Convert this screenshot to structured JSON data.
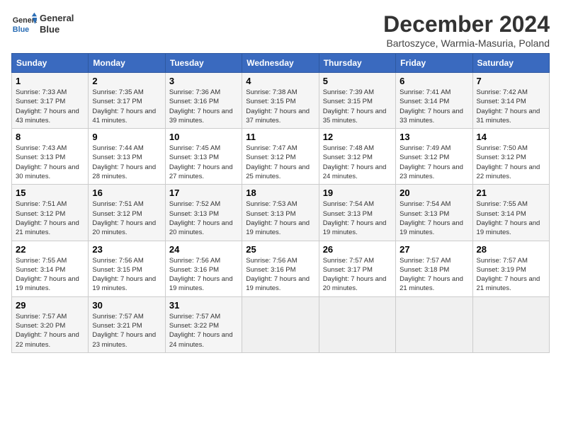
{
  "header": {
    "logo_line1": "General",
    "logo_line2": "Blue",
    "month_title": "December 2024",
    "subtitle": "Bartoszyce, Warmia-Masuria, Poland"
  },
  "days_of_week": [
    "Sunday",
    "Monday",
    "Tuesday",
    "Wednesday",
    "Thursday",
    "Friday",
    "Saturday"
  ],
  "weeks": [
    [
      {
        "day": "1",
        "sunrise": "Sunrise: 7:33 AM",
        "sunset": "Sunset: 3:17 PM",
        "daylight": "Daylight: 7 hours and 43 minutes."
      },
      {
        "day": "2",
        "sunrise": "Sunrise: 7:35 AM",
        "sunset": "Sunset: 3:17 PM",
        "daylight": "Daylight: 7 hours and 41 minutes."
      },
      {
        "day": "3",
        "sunrise": "Sunrise: 7:36 AM",
        "sunset": "Sunset: 3:16 PM",
        "daylight": "Daylight: 7 hours and 39 minutes."
      },
      {
        "day": "4",
        "sunrise": "Sunrise: 7:38 AM",
        "sunset": "Sunset: 3:15 PM",
        "daylight": "Daylight: 7 hours and 37 minutes."
      },
      {
        "day": "5",
        "sunrise": "Sunrise: 7:39 AM",
        "sunset": "Sunset: 3:15 PM",
        "daylight": "Daylight: 7 hours and 35 minutes."
      },
      {
        "day": "6",
        "sunrise": "Sunrise: 7:41 AM",
        "sunset": "Sunset: 3:14 PM",
        "daylight": "Daylight: 7 hours and 33 minutes."
      },
      {
        "day": "7",
        "sunrise": "Sunrise: 7:42 AM",
        "sunset": "Sunset: 3:14 PM",
        "daylight": "Daylight: 7 hours and 31 minutes."
      }
    ],
    [
      {
        "day": "8",
        "sunrise": "Sunrise: 7:43 AM",
        "sunset": "Sunset: 3:13 PM",
        "daylight": "Daylight: 7 hours and 30 minutes."
      },
      {
        "day": "9",
        "sunrise": "Sunrise: 7:44 AM",
        "sunset": "Sunset: 3:13 PM",
        "daylight": "Daylight: 7 hours and 28 minutes."
      },
      {
        "day": "10",
        "sunrise": "Sunrise: 7:45 AM",
        "sunset": "Sunset: 3:13 PM",
        "daylight": "Daylight: 7 hours and 27 minutes."
      },
      {
        "day": "11",
        "sunrise": "Sunrise: 7:47 AM",
        "sunset": "Sunset: 3:12 PM",
        "daylight": "Daylight: 7 hours and 25 minutes."
      },
      {
        "day": "12",
        "sunrise": "Sunrise: 7:48 AM",
        "sunset": "Sunset: 3:12 PM",
        "daylight": "Daylight: 7 hours and 24 minutes."
      },
      {
        "day": "13",
        "sunrise": "Sunrise: 7:49 AM",
        "sunset": "Sunset: 3:12 PM",
        "daylight": "Daylight: 7 hours and 23 minutes."
      },
      {
        "day": "14",
        "sunrise": "Sunrise: 7:50 AM",
        "sunset": "Sunset: 3:12 PM",
        "daylight": "Daylight: 7 hours and 22 minutes."
      }
    ],
    [
      {
        "day": "15",
        "sunrise": "Sunrise: 7:51 AM",
        "sunset": "Sunset: 3:12 PM",
        "daylight": "Daylight: 7 hours and 21 minutes."
      },
      {
        "day": "16",
        "sunrise": "Sunrise: 7:51 AM",
        "sunset": "Sunset: 3:12 PM",
        "daylight": "Daylight: 7 hours and 20 minutes."
      },
      {
        "day": "17",
        "sunrise": "Sunrise: 7:52 AM",
        "sunset": "Sunset: 3:13 PM",
        "daylight": "Daylight: 7 hours and 20 minutes."
      },
      {
        "day": "18",
        "sunrise": "Sunrise: 7:53 AM",
        "sunset": "Sunset: 3:13 PM",
        "daylight": "Daylight: 7 hours and 19 minutes."
      },
      {
        "day": "19",
        "sunrise": "Sunrise: 7:54 AM",
        "sunset": "Sunset: 3:13 PM",
        "daylight": "Daylight: 7 hours and 19 minutes."
      },
      {
        "day": "20",
        "sunrise": "Sunrise: 7:54 AM",
        "sunset": "Sunset: 3:13 PM",
        "daylight": "Daylight: 7 hours and 19 minutes."
      },
      {
        "day": "21",
        "sunrise": "Sunrise: 7:55 AM",
        "sunset": "Sunset: 3:14 PM",
        "daylight": "Daylight: 7 hours and 19 minutes."
      }
    ],
    [
      {
        "day": "22",
        "sunrise": "Sunrise: 7:55 AM",
        "sunset": "Sunset: 3:14 PM",
        "daylight": "Daylight: 7 hours and 19 minutes."
      },
      {
        "day": "23",
        "sunrise": "Sunrise: 7:56 AM",
        "sunset": "Sunset: 3:15 PM",
        "daylight": "Daylight: 7 hours and 19 minutes."
      },
      {
        "day": "24",
        "sunrise": "Sunrise: 7:56 AM",
        "sunset": "Sunset: 3:16 PM",
        "daylight": "Daylight: 7 hours and 19 minutes."
      },
      {
        "day": "25",
        "sunrise": "Sunrise: 7:56 AM",
        "sunset": "Sunset: 3:16 PM",
        "daylight": "Daylight: 7 hours and 19 minutes."
      },
      {
        "day": "26",
        "sunrise": "Sunrise: 7:57 AM",
        "sunset": "Sunset: 3:17 PM",
        "daylight": "Daylight: 7 hours and 20 minutes."
      },
      {
        "day": "27",
        "sunrise": "Sunrise: 7:57 AM",
        "sunset": "Sunset: 3:18 PM",
        "daylight": "Daylight: 7 hours and 21 minutes."
      },
      {
        "day": "28",
        "sunrise": "Sunrise: 7:57 AM",
        "sunset": "Sunset: 3:19 PM",
        "daylight": "Daylight: 7 hours and 21 minutes."
      }
    ],
    [
      {
        "day": "29",
        "sunrise": "Sunrise: 7:57 AM",
        "sunset": "Sunset: 3:20 PM",
        "daylight": "Daylight: 7 hours and 22 minutes."
      },
      {
        "day": "30",
        "sunrise": "Sunrise: 7:57 AM",
        "sunset": "Sunset: 3:21 PM",
        "daylight": "Daylight: 7 hours and 23 minutes."
      },
      {
        "day": "31",
        "sunrise": "Sunrise: 7:57 AM",
        "sunset": "Sunset: 3:22 PM",
        "daylight": "Daylight: 7 hours and 24 minutes."
      },
      null,
      null,
      null,
      null
    ]
  ]
}
